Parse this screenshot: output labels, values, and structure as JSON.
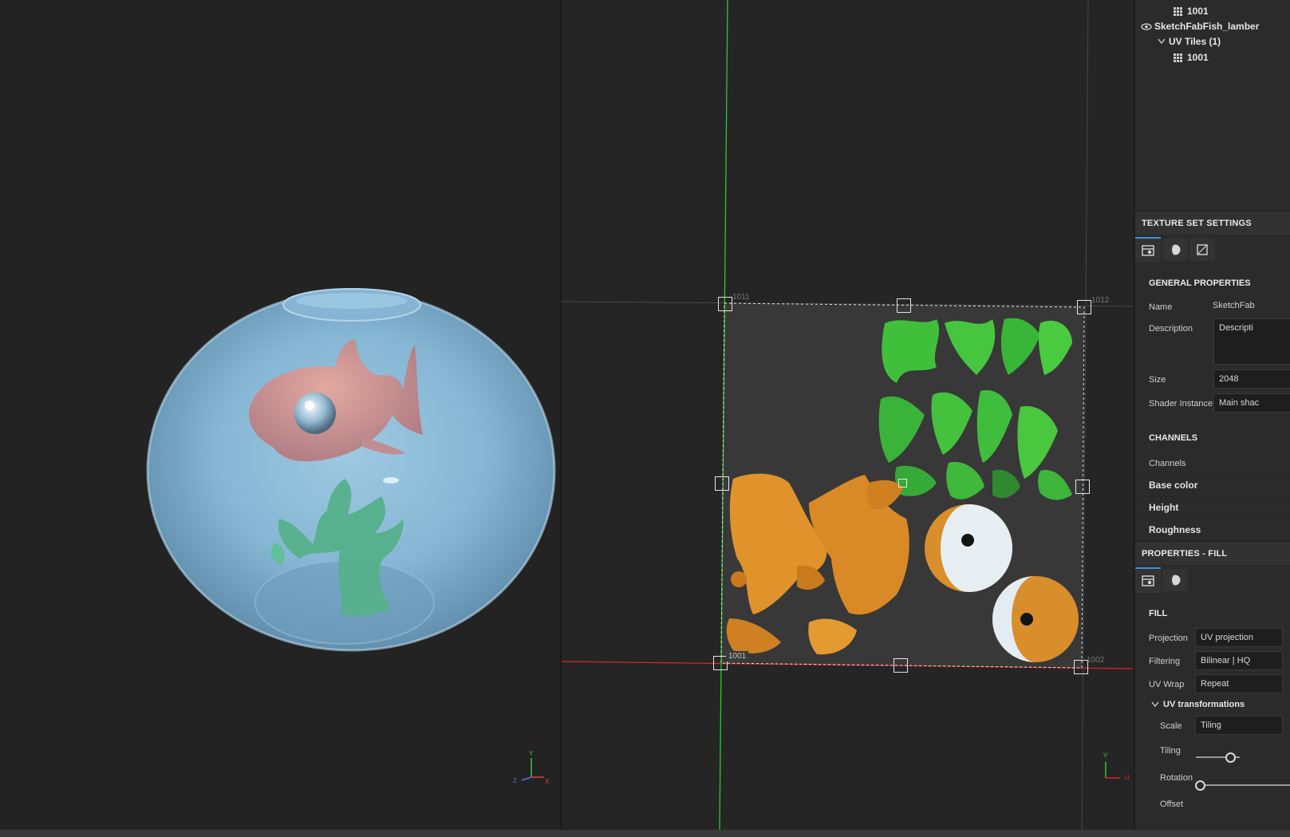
{
  "layer_tree": {
    "items": [
      {
        "label": "1001",
        "kind": "tile"
      },
      {
        "label": "SketchFabFish_lamber",
        "kind": "texture-set"
      },
      {
        "label": "UV Tiles (1)",
        "kind": "group"
      },
      {
        "label": "1001",
        "kind": "tile"
      }
    ]
  },
  "texture_set_settings": {
    "title": "TEXTURE SET SETTINGS",
    "general_title": "GENERAL PROPERTIES",
    "name_label": "Name",
    "name_value": "SketchFab",
    "description_label": "Description",
    "description_value": "Descripti",
    "size_label": "Size",
    "size_value": "2048",
    "shader_label": "Shader Instance",
    "shader_value": "Main shac",
    "channels_title": "CHANNELS",
    "channels_label": "Channels",
    "channels": [
      "Base color",
      "Height",
      "Roughness"
    ]
  },
  "properties_fill": {
    "title": "PROPERTIES - FILL",
    "fill_title": "FILL",
    "projection_label": "Projection",
    "projection_value": "UV projection",
    "filtering_label": "Filtering",
    "filtering_value": "Bilinear | HQ",
    "uvwrap_label": "UV Wrap",
    "uvwrap_value": "Repeat",
    "uv_transform_title": "UV transformations",
    "scale_label": "Scale",
    "scale_value": "Tiling",
    "tiling_label": "Tiling",
    "rotation_label": "Rotation",
    "offset_label": "Offset",
    "tiling_fraction": 0.78,
    "rotation_fraction": 0.0
  },
  "uv_view": {
    "tile_labels": [
      "1011",
      "1012",
      "1001",
      "1002"
    ],
    "axis_u": "U",
    "axis_v": "V"
  },
  "viewport_3d": {
    "axis_x": "X",
    "axis_y": "Y",
    "axis_z": "Z"
  },
  "colors": {
    "accent": "#3b8ee0",
    "u_axis": "#d02a2a",
    "v_axis": "#2cc82c"
  }
}
